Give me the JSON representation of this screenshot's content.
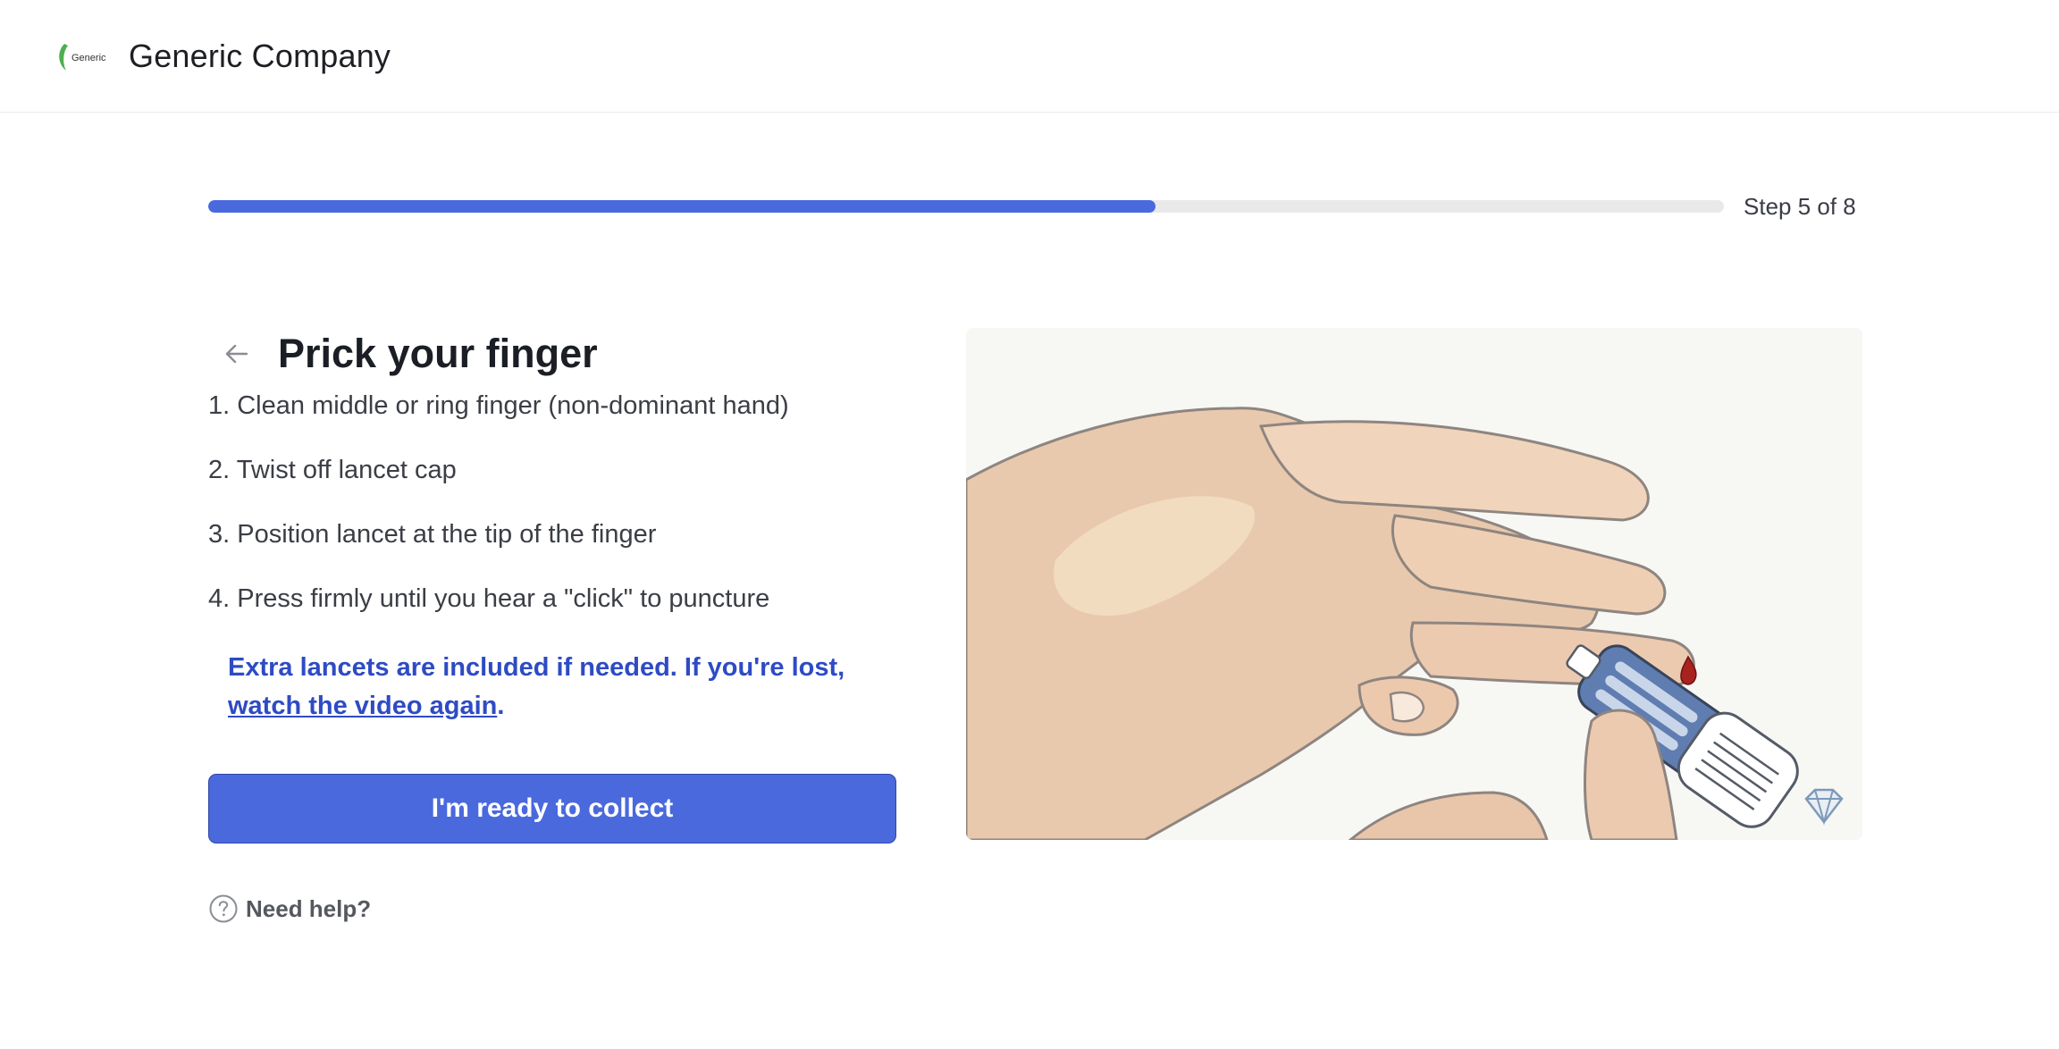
{
  "header": {
    "logo_text": "Generic",
    "company_name": "Generic Company",
    "brand_green": "#4caf50"
  },
  "progress": {
    "current_step": 5,
    "total_steps": 8,
    "fill_fraction": 0.625,
    "label": "Step 5 of 8",
    "fill_color": "#4a69dd"
  },
  "main": {
    "back_icon": "arrow-left-icon",
    "title": "Prick your finger",
    "steps": [
      "1. Clean middle or ring finger (non-dominant hand)",
      "2. Twist off lancet cap",
      "3. Position lancet at the tip of the finger",
      "4. Press firmly until you hear a \"click\" to puncture"
    ],
    "note_text": "Extra lancets are included if needed. If you're lost, ",
    "note_link": "watch the video again",
    "note_end": ".",
    "note_color": "#2e4bc4",
    "cta_label": "I'm ready to collect",
    "help_icon": "question-circle-icon",
    "help_label": "Need help?"
  },
  "illustration": {
    "subject": "hand-pricking-finger-with-lancet",
    "badge_icon": "diamond-sparkle-icon"
  }
}
